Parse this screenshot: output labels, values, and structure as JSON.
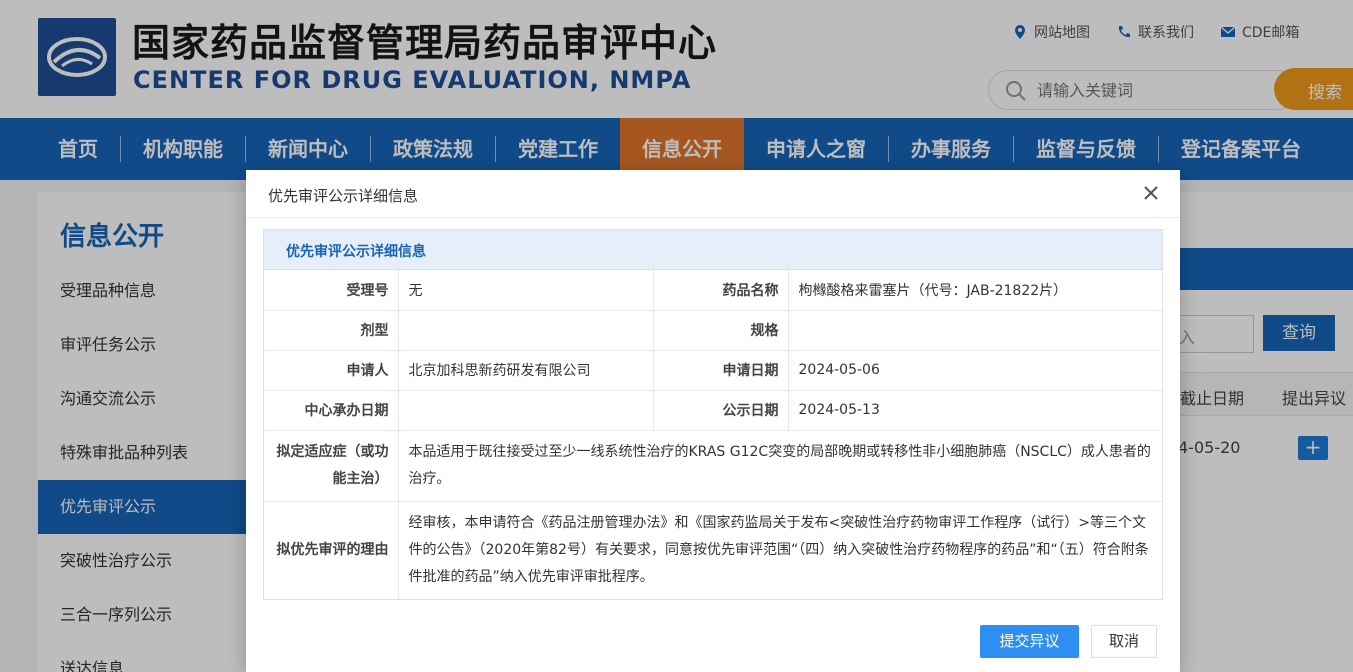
{
  "header": {
    "title_cn": "国家药品监督管理局药品审评中心",
    "title_en": "CENTER FOR DRUG EVALUATION, NMPA",
    "links": [
      "网站地图",
      "联系我们",
      "CDE邮箱"
    ],
    "search_placeholder": "请输入关键词",
    "search_button": "搜索"
  },
  "nav": {
    "items": [
      "首页",
      "机构职能",
      "新闻中心",
      "政策法规",
      "党建工作",
      "信息公开",
      "申请人之窗",
      "办事服务",
      "监督与反馈",
      "登记备案平台"
    ],
    "active_index": 5
  },
  "sidebar": {
    "title": "信息公开",
    "items": [
      "受理品种信息",
      "审评任务公示",
      "沟通交流公示",
      "特殊审批品种列表",
      "优先审评公示",
      "突破性治疗公示",
      "三合一序列公示",
      "送达信息"
    ],
    "active_index": 4
  },
  "background": {
    "query_button": "查询",
    "input_fragment": "入",
    "col_deadline": "截止日期",
    "col_objection": "提出异议",
    "row_date": "4-05-20",
    "plus": "+"
  },
  "modal": {
    "title": "优先审评公示详细信息",
    "section_title": "优先审评公示详细信息",
    "rows": {
      "accept_no_label": "受理号",
      "accept_no": "无",
      "drug_name_label": "药品名称",
      "drug_name": "枸橼酸格来雷塞片（代号：JAB-21822片）",
      "dosage_label": "剂型",
      "dosage": "",
      "spec_label": "规格",
      "spec": "",
      "applicant_label": "申请人",
      "applicant": "北京加科思新药研发有限公司",
      "apply_date_label": "申请日期",
      "apply_date": "2024-05-06",
      "center_date_label": "中心承办日期",
      "center_date": "",
      "public_date_label": "公示日期",
      "public_date": "2024-05-13",
      "indication_label": "拟定适应症（或功能主治）",
      "indication": "本品适用于既往接受过至少一线系统性治疗的KRAS G12C突变的局部晚期或转移性非小细胞肺癌（NSCLC）成人患者的治疗。",
      "reason_label": "拟优先审评的理由",
      "reason": "经审核，本申请符合《药品注册管理办法》和《国家药监局关于发布<突破性治疗药物审评工作程序（试行）>等三个文件的公告》（2020年第82号）有关要求，同意按优先审评范围“（四）纳入突破性治疗药物程序的药品”和“（五）符合附条件批准的药品”纳入优先审评审批程序。"
    },
    "submit_button": "提交异议",
    "cancel_button": "取消"
  },
  "colors": {
    "brand_blue": "#1664b8",
    "nav_active": "#e0762c",
    "search_orange": "#ef9a1d",
    "submit_blue": "#2e8ff0"
  }
}
